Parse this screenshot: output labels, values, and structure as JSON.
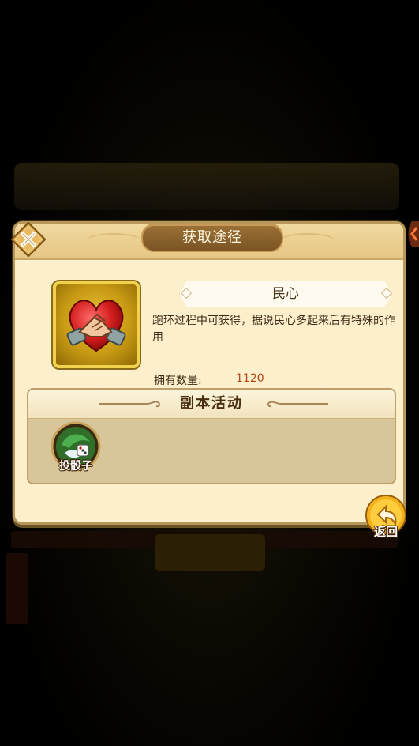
{
  "dialog": {
    "title": "获取途径",
    "item": {
      "name": "民心",
      "icon": "heart-handshake-icon",
      "description": "跑环过程中可获得，据说民心多起来后有特殊的作用",
      "owned_label": "拥有数量:",
      "owned_value": "1120"
    },
    "source_section": {
      "title": "副本活动",
      "activities": [
        {
          "label": "投骰子",
          "icon": "dice-icon"
        }
      ]
    }
  },
  "buttons": {
    "close_icon": "close-x-icon",
    "return_label": "返回"
  },
  "colors": {
    "panel_bg": "#fbf0cb",
    "title_plate": "#8a6230",
    "owned_value": "#b5461a",
    "gold_frame": "#f1d24f"
  }
}
